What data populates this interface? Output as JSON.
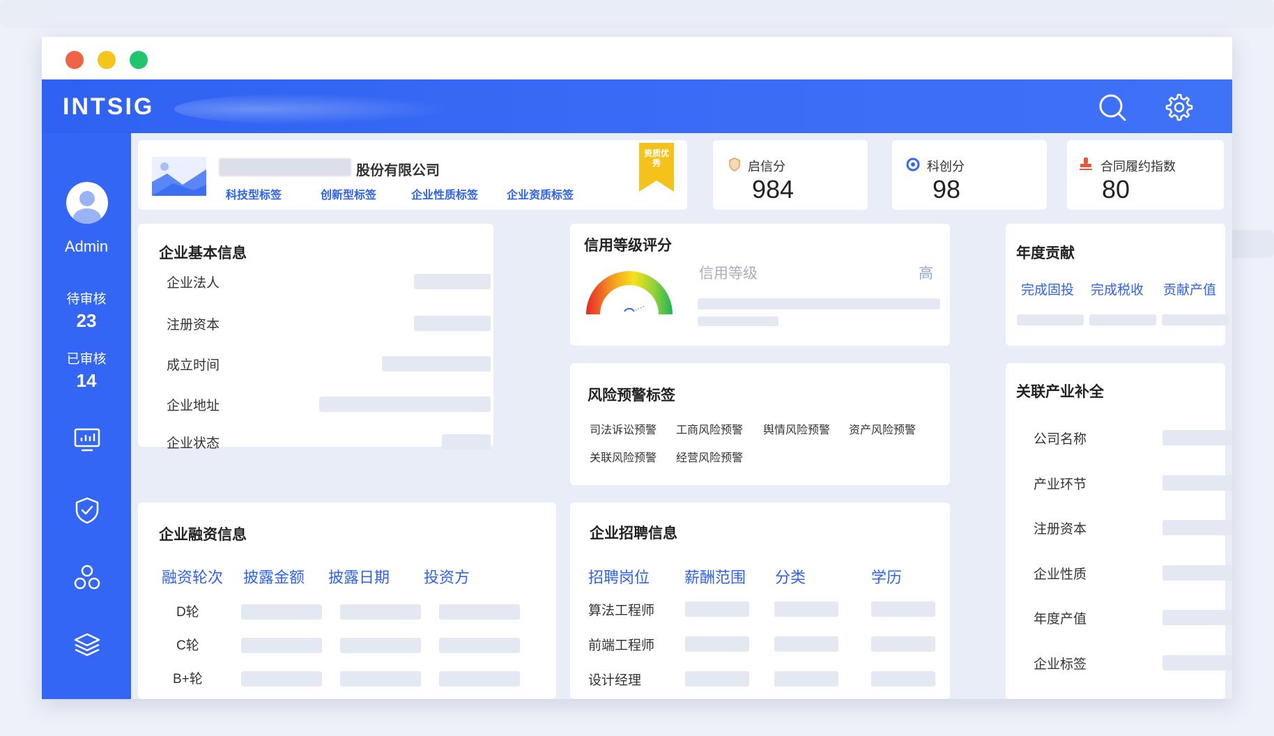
{
  "colors": {
    "accent": "#3466f5",
    "link": "#2e63e8",
    "badge": "#f5c21b"
  },
  "app": {
    "logo": "INTSIG"
  },
  "icons": {
    "search": "search-icon",
    "settings": "gear-icon"
  },
  "sidebar": {
    "username": "Admin",
    "pending_label": "待审核",
    "pending_count": "23",
    "reviewed_label": "已审核",
    "reviewed_count": "14",
    "nav": [
      "monitor-icon",
      "shield-check-icon",
      "modules-icon",
      "layers-icon"
    ]
  },
  "company": {
    "name_suffix": "股份有限公司",
    "tags": [
      "科技型标签",
      "创新型标签",
      "企业性质标签",
      "企业资质标签"
    ],
    "badge": "资质优秀"
  },
  "metrics": [
    {
      "label": "启信分",
      "value": "984"
    },
    {
      "label": "科创分",
      "value": "98"
    },
    {
      "label": "合同履约指数",
      "value": "80"
    }
  ],
  "basic_info": {
    "title": "企业基本信息",
    "fields": [
      "企业法人",
      "注册资本",
      "成立时间",
      "企业地址",
      "企业状态"
    ]
  },
  "credit": {
    "title": "信用等级评分",
    "label": "信用等级",
    "level": "高"
  },
  "annual": {
    "title": "年度贡献",
    "items": [
      "完成固投",
      "完成税收",
      "贡献产值"
    ]
  },
  "risk": {
    "title": "风险预警标签",
    "tags_row1": [
      "司法诉讼预警",
      "工商风险预警",
      "舆情风险预警",
      "资产风险预警"
    ],
    "tags_row2": [
      "关联风险预警",
      "经营风险预警"
    ]
  },
  "related": {
    "title": "关联产业补全",
    "fields": [
      "公司名称",
      "产业环节",
      "注册资本",
      "企业性质",
      "年度产值",
      "企业标签"
    ]
  },
  "financing": {
    "title": "企业融资信息",
    "headers": [
      "融资轮次",
      "披露金额",
      "披露日期",
      "投资方"
    ],
    "rounds": [
      "D轮",
      "C轮",
      "B+轮"
    ]
  },
  "recruit": {
    "title": "企业招聘信息",
    "headers": [
      "招聘岗位",
      "薪酬范围",
      "分类",
      "学历"
    ],
    "jobs": [
      "算法工程师",
      "前端工程师",
      "设计经理"
    ]
  }
}
